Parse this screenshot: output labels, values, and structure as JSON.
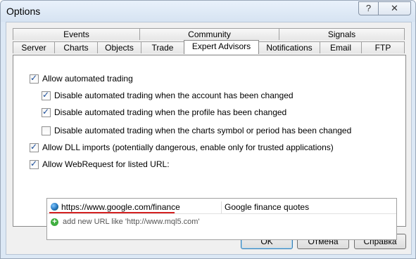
{
  "window": {
    "title": "Options",
    "help_label": "?",
    "close_label": "✕"
  },
  "tabs": {
    "row1": [
      "Events",
      "Community",
      "Signals"
    ],
    "row2": [
      "Server",
      "Charts",
      "Objects",
      "Trade",
      "Expert Advisors",
      "Notifications",
      "Email",
      "FTP"
    ],
    "active": "Expert Advisors"
  },
  "options": [
    {
      "label": "Allow automated trading",
      "checked": true
    },
    {
      "label": "Disable automated trading when the account has been changed",
      "checked": true
    },
    {
      "label": "Disable automated trading when the profile has been changed",
      "checked": true
    },
    {
      "label": "Disable automated trading when the charts symbol or period has been changed",
      "checked": false
    },
    {
      "label": "Allow DLL imports (potentially dangerous, enable only for trusted applications)",
      "checked": true
    },
    {
      "label": "Allow WebRequest for listed URL:",
      "checked": true
    }
  ],
  "url_list": {
    "items": [
      {
        "url": "https://www.google.com/finance",
        "description": "Google finance quotes"
      }
    ],
    "add_hint": "add new URL like 'http://www.mql5.com'"
  },
  "buttons": {
    "ok": "OK",
    "cancel": "Отмена",
    "help": "Справка"
  },
  "colors": {
    "checkmark": "#1a4d99",
    "underline": "#d42020",
    "add_icon": "#3fae3f"
  }
}
